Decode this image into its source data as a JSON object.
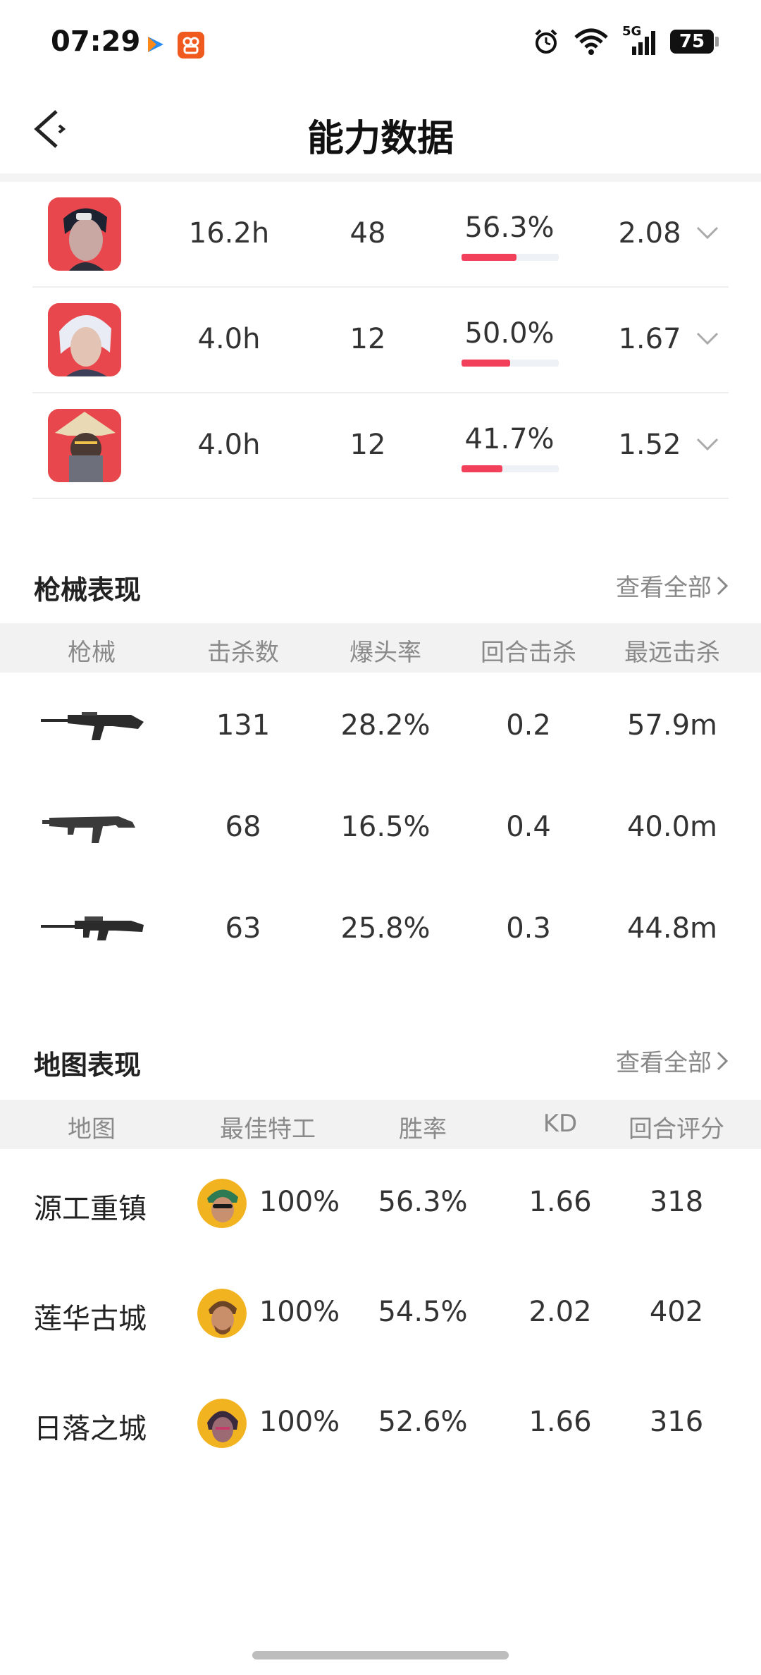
{
  "status_bar": {
    "time": "07:29",
    "network": "5G",
    "battery": "75",
    "icons": [
      "alarm-icon",
      "wifi-icon",
      "signal-icon"
    ]
  },
  "header": {
    "title": "能力数据",
    "back_icon": "back-arrow-icon"
  },
  "agents": [
    {
      "time": "16.2h",
      "games": "48",
      "win_rate": "56.3%",
      "win_rate_value": 0.563,
      "kd": "2.08"
    },
    {
      "time": "4.0h",
      "games": "12",
      "win_rate": "50.0%",
      "win_rate_value": 0.5,
      "kd": "1.67"
    },
    {
      "time": "4.0h",
      "games": "12",
      "win_rate": "41.7%",
      "win_rate_value": 0.417,
      "kd": "1.52"
    }
  ],
  "weapons": {
    "title": "枪械表现",
    "see_all": "查看全部",
    "columns": [
      "枪械",
      "击杀数",
      "爆头率",
      "回合击杀",
      "最远击杀"
    ],
    "rows": [
      {
        "kills": "131",
        "headshot": "28.2%",
        "round_kills": "0.2",
        "longest": "57.9m"
      },
      {
        "kills": "68",
        "headshot": "16.5%",
        "round_kills": "0.4",
        "longest": "40.0m"
      },
      {
        "kills": "63",
        "headshot": "25.8%",
        "round_kills": "0.3",
        "longest": "44.8m"
      }
    ]
  },
  "maps": {
    "title": "地图表现",
    "see_all": "查看全部",
    "columns": [
      "地图",
      "最佳特工",
      "胜率",
      "KD",
      "回合评分"
    ],
    "rows": [
      {
        "name": "源工重镇",
        "best_agent": "100%",
        "win_rate": "56.3%",
        "kd": "1.66",
        "score": "318"
      },
      {
        "name": "莲华古城",
        "best_agent": "100%",
        "win_rate": "54.5%",
        "kd": "2.02",
        "score": "402"
      },
      {
        "name": "日落之城",
        "best_agent": "100%",
        "win_rate": "52.6%",
        "kd": "1.66",
        "score": "316"
      }
    ]
  },
  "colors": {
    "accent": "#f2405a",
    "agent_bg": "#e8484d",
    "table_header_bg": "#f2f2f2"
  }
}
